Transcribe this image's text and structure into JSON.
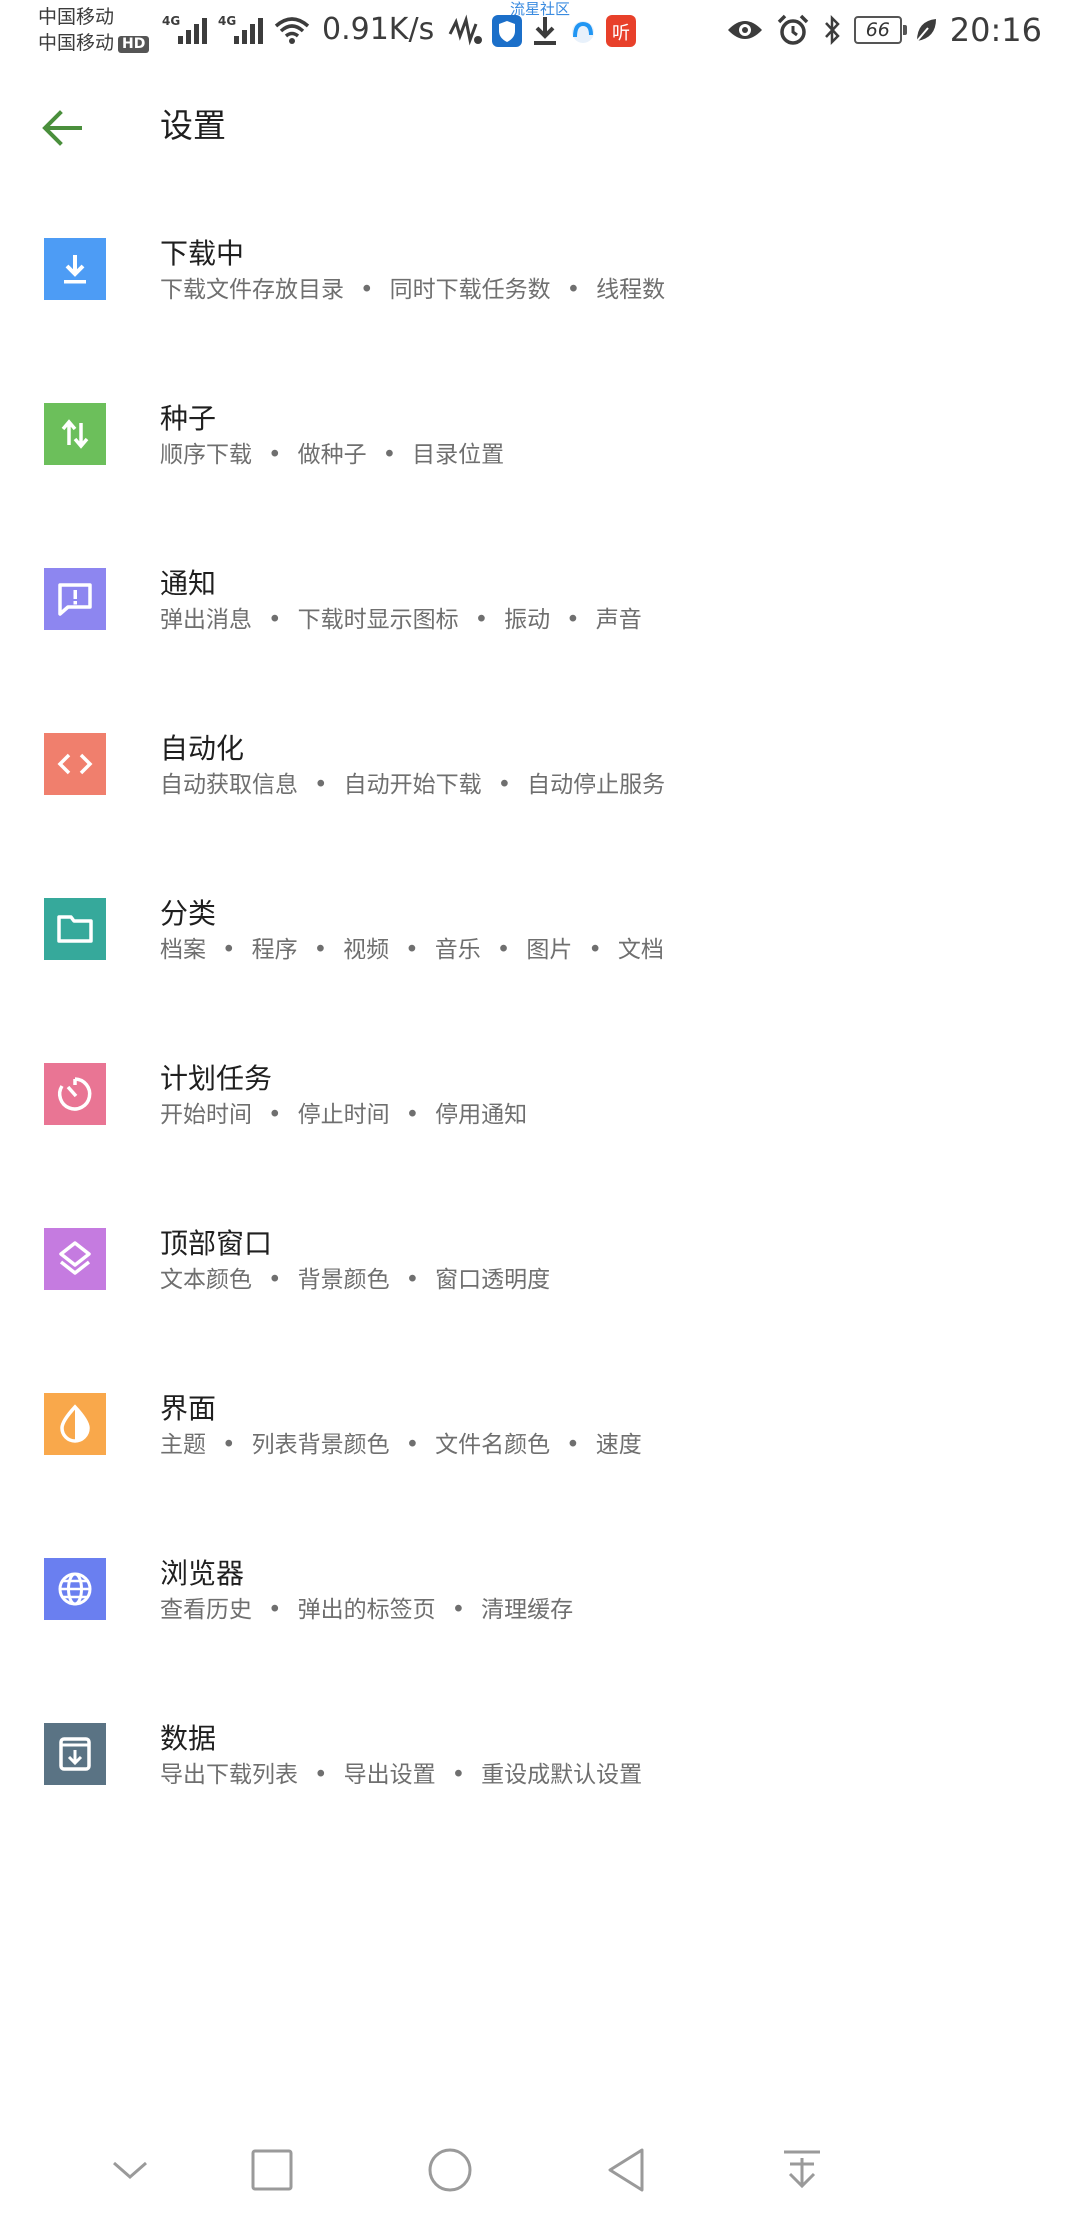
{
  "status_bar": {
    "carrier_1": "中国移动",
    "carrier_2": "中国移动",
    "hd_badge": "HD",
    "network_1": "4G",
    "network_2": "4G",
    "net_speed": "0.91K/s",
    "notice_text": "流星社区",
    "app_icon_red_text": "听",
    "battery_level": "66",
    "time": "20:16",
    "icons": [
      "signal-icon",
      "wifi-icon",
      "notification-icon",
      "shield-app-icon",
      "download-icon",
      "app-icon",
      "eye-icon",
      "alarm-icon",
      "bluetooth-icon",
      "battery-icon",
      "leaf-icon"
    ]
  },
  "app_bar": {
    "title": "设置",
    "back_icon": "arrow-left-icon",
    "accent_color": "#4a8f3c"
  },
  "settings": [
    {
      "key": "downloading",
      "title": "下载中",
      "icon": "download-icon",
      "color": "#4d9cf5",
      "subitems": [
        "下载文件存放目录",
        "同时下载任务数",
        "线程数"
      ]
    },
    {
      "key": "torrent",
      "title": "种子",
      "icon": "swap-vertical-icon",
      "color": "#6cbf5b",
      "subitems": [
        "顺序下载",
        "做种子",
        "目录位置"
      ]
    },
    {
      "key": "notification",
      "title": "通知",
      "icon": "message-alert-icon",
      "color": "#8d86f0",
      "subitems": [
        "弹出消息",
        "下载时显示图标",
        "振动",
        "声音"
      ]
    },
    {
      "key": "automation",
      "title": "自动化",
      "icon": "code-icon",
      "color": "#f07f6d",
      "subitems": [
        "自动获取信息",
        "自动开始下载",
        "自动停止服务"
      ]
    },
    {
      "key": "category",
      "title": "分类",
      "icon": "folder-icon",
      "color": "#36a99b",
      "subitems": [
        "档案",
        "程序",
        "视频",
        "音乐",
        "图片",
        "文档"
      ]
    },
    {
      "key": "schedule",
      "title": "计划任务",
      "icon": "timer-icon",
      "color": "#e97594",
      "subitems": [
        "开始时间",
        "停止时间",
        "停用通知"
      ]
    },
    {
      "key": "top_window",
      "title": "顶部窗口",
      "icon": "layers-icon",
      "color": "#c57be0",
      "subitems": [
        "文本颜色",
        "背景颜色",
        "窗口透明度"
      ]
    },
    {
      "key": "interface",
      "title": "界面",
      "icon": "contrast-drop-icon",
      "color": "#f9a84b",
      "subitems": [
        "主题",
        "列表背景颜色",
        "文件名颜色",
        "速度"
      ]
    },
    {
      "key": "browser",
      "title": "浏览器",
      "icon": "globe-icon",
      "color": "#6a7ff0",
      "subitems": [
        "查看历史",
        "弹出的标签页",
        "清理缓存"
      ]
    },
    {
      "key": "data",
      "title": "数据",
      "icon": "archive-icon",
      "color": "#5a7384",
      "subitems": [
        "导出下载列表",
        "导出设置",
        "重设成默认设置"
      ]
    }
  ],
  "nav_bar": {
    "buttons": [
      "chevron-down-icon",
      "square-icon",
      "circle-icon",
      "triangle-back-icon",
      "pull-down-icon"
    ]
  }
}
